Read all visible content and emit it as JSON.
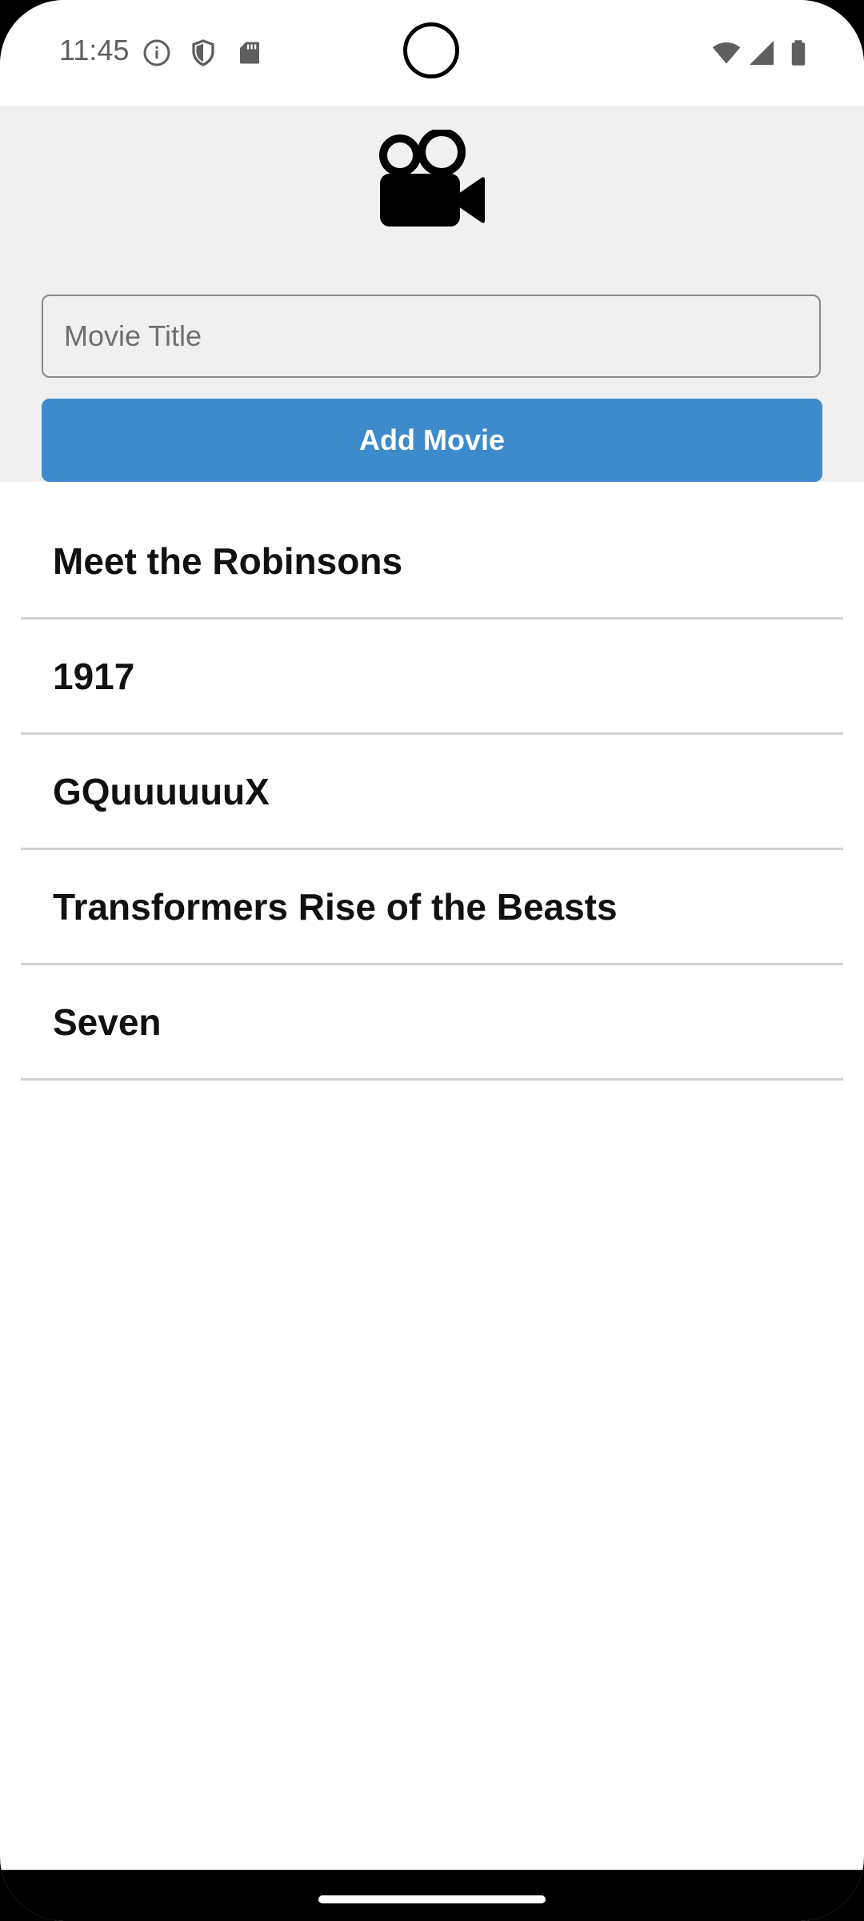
{
  "status_bar": {
    "time": "11:45",
    "left_icons": [
      "info-icon",
      "shield-icon",
      "sd-card-icon"
    ],
    "right_icons": [
      "wifi-icon",
      "cell-signal-icon",
      "battery-icon"
    ]
  },
  "header": {
    "icon": "movie-camera-icon",
    "input_placeholder": "Movie Title",
    "input_value": "",
    "add_button_label": "Add Movie",
    "accent_color": "#3e8bcb"
  },
  "movies": [
    {
      "title": "Meet the Robinsons"
    },
    {
      "title": "1917"
    },
    {
      "title": "GQuuuuuuX"
    },
    {
      "title": "Transformers Rise of the Beasts"
    },
    {
      "title": "Seven"
    }
  ]
}
